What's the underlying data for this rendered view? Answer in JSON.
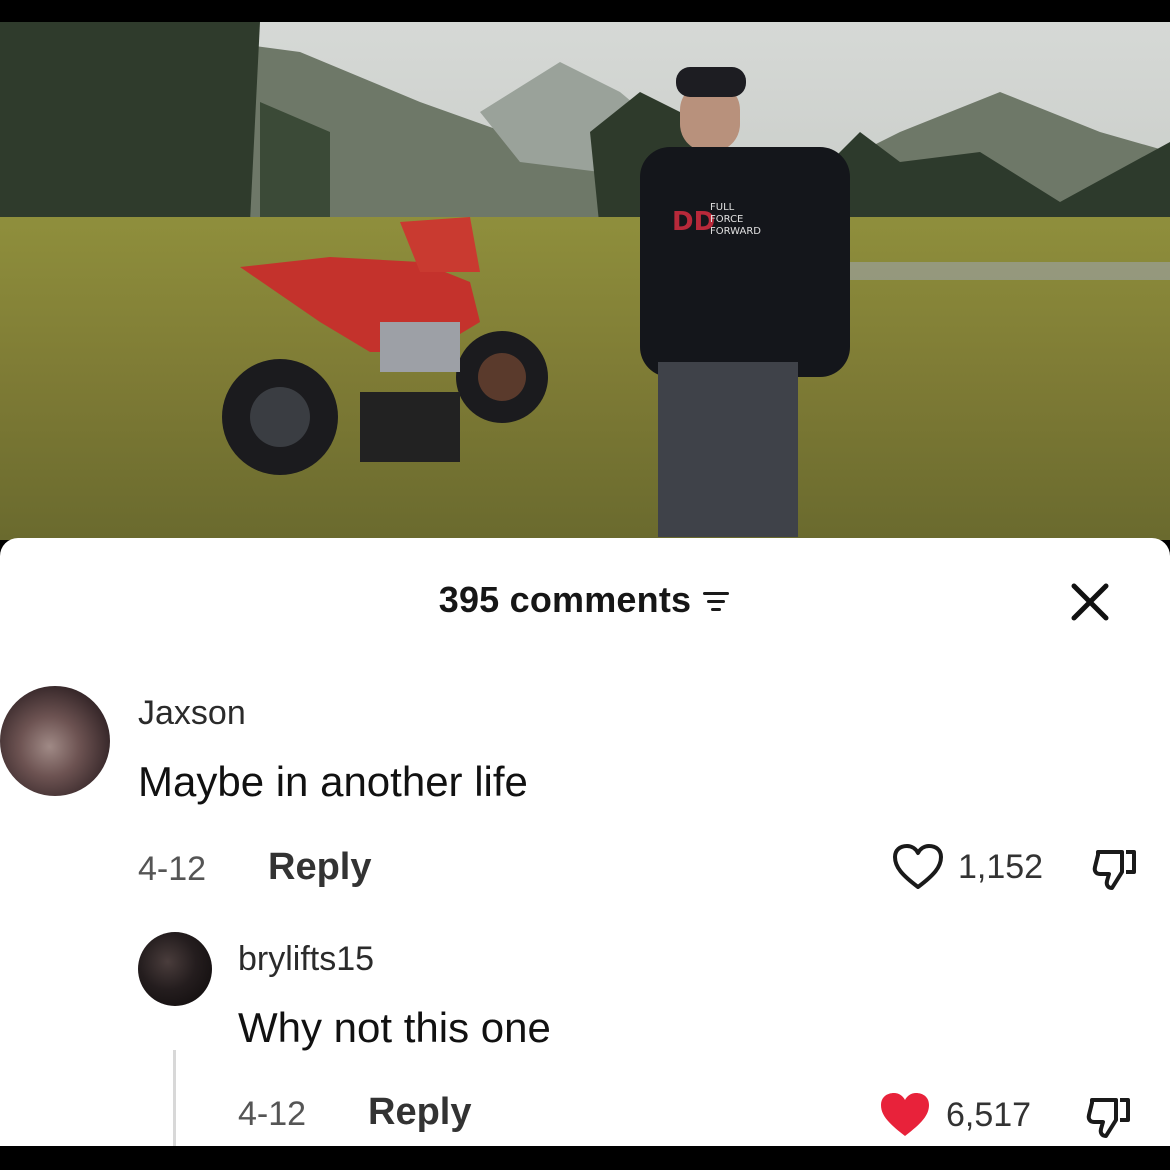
{
  "comments_header": {
    "count_label": "395 comments"
  },
  "comments": [
    {
      "username": "Jaxson",
      "text": "Maybe in another life",
      "date": "4-12",
      "reply_label": "Reply",
      "likes": "1,152",
      "liked": false
    },
    {
      "username": "brylifts15",
      "text": "Why not this one",
      "date": "4-12",
      "reply_label": "Reply",
      "likes": "6,517",
      "liked": true
    }
  ],
  "colors": {
    "like_active": "#e8223a",
    "panel_bg": "#ffffff"
  },
  "icons": [
    "filter-icon",
    "close-icon",
    "heart-icon",
    "dislike-icon"
  ]
}
